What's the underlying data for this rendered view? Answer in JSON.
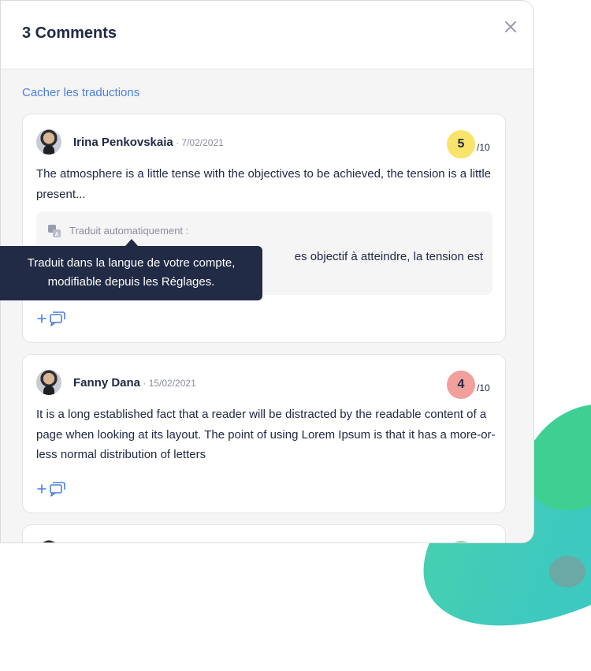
{
  "modal": {
    "title": "3 Comments",
    "hide_translations_label": "Cacher les traductions"
  },
  "comments": [
    {
      "author": "Irina Penkovskaia",
      "date": " · 7/02/2021",
      "score": "5",
      "score_max": "/10",
      "score_color": "#fae36a",
      "text": "The atmosphere is a little tense with the objectives to be achieved, the tension is a little present...",
      "translation_label": "Traduit automatiquement :",
      "translation_text_visible": "es objectif à atteindre, la tension est"
    },
    {
      "author": "Fanny Dana",
      "date": " · 15/02/2021",
      "score": "4",
      "score_max": "/10",
      "score_color": "#f2a09c",
      "text": "It is a long established fact that a reader will be distracted by the readable content of a page when looking at its layout. The point of using Lorem Ipsum is that it has a more-or-less normal distribution of letters"
    }
  ],
  "tooltip": {
    "line1": "Traduit dans la langue de votre compte,",
    "line2": "modifiable depuis les Réglages."
  },
  "colors": {
    "accent": "#4a7fe0",
    "tooltip_bg": "#222b45",
    "text": "#222845"
  },
  "icons": {
    "close": "close-icon",
    "translate": "translate-icon",
    "reply": "add-reply-icon"
  }
}
